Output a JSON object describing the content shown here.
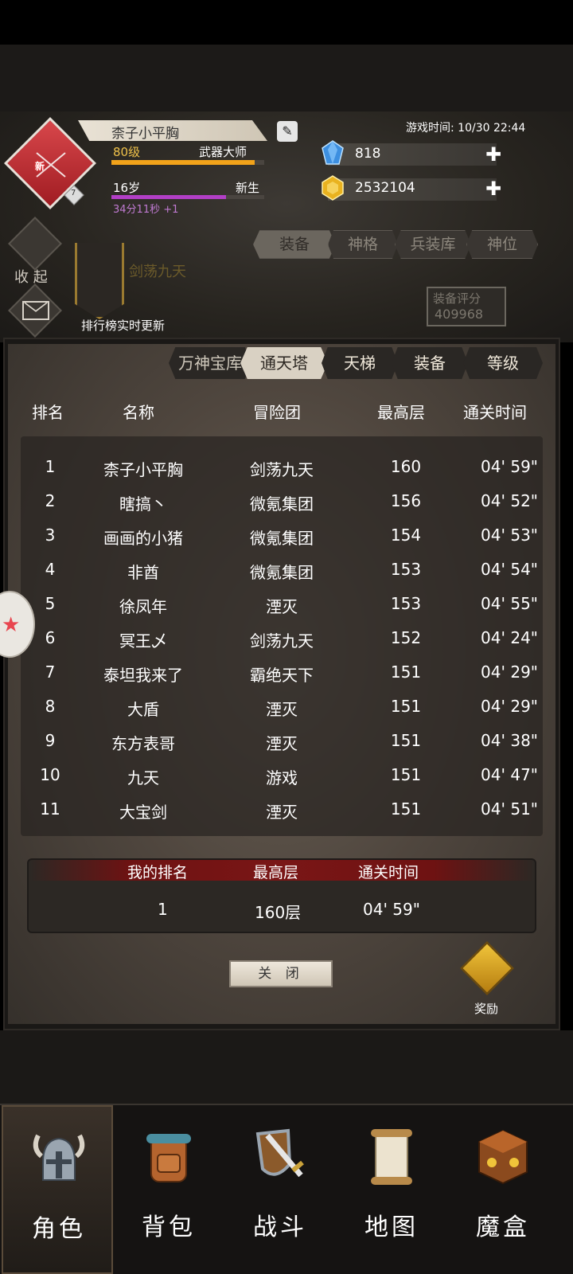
{
  "player": {
    "new_tag": "新",
    "badge_level": "7",
    "name": "柰子小平胸",
    "level": "80级",
    "title": "武器大师",
    "age": "16岁",
    "stage": "新生",
    "timer": "34分11秒 +1"
  },
  "game_time": "游戏时间: 10/30 22:44",
  "currency": {
    "gems": "818",
    "gold": "2532104"
  },
  "side": {
    "collapse": "收 起"
  },
  "guild": {
    "name": "剑荡九天",
    "rank_update": "排行榜实时更新"
  },
  "top_tabs": [
    "装备",
    "神格",
    "兵装库",
    "神位"
  ],
  "score": {
    "label": "装备评分",
    "value": "409968"
  },
  "rank_tabs": [
    "万神宝库",
    "通天塔",
    "天梯",
    "装备",
    "等级"
  ],
  "columns": [
    "排名",
    "名称",
    "冒险团",
    "最高层",
    "通关时间"
  ],
  "rows": [
    {
      "rank": "1",
      "name": "柰子小平胸",
      "guild": "剑荡九天",
      "floor": "160",
      "time": "04' 59\""
    },
    {
      "rank": "2",
      "name": "瞎搞丶",
      "guild": "微氪集团",
      "floor": "156",
      "time": "04' 52\""
    },
    {
      "rank": "3",
      "name": "画画的小猪",
      "guild": "微氪集团",
      "floor": "154",
      "time": "04' 53\""
    },
    {
      "rank": "4",
      "name": "非酋",
      "guild": "微氪集团",
      "floor": "153",
      "time": "04' 54\""
    },
    {
      "rank": "5",
      "name": "徐凤年",
      "guild": "湮灭",
      "floor": "153",
      "time": "04' 55\""
    },
    {
      "rank": "6",
      "name": "冥王乄",
      "guild": "剑荡九天",
      "floor": "152",
      "time": "04' 24\""
    },
    {
      "rank": "7",
      "name": "泰坦我来了",
      "guild": "霸绝天下",
      "floor": "151",
      "time": "04' 29\""
    },
    {
      "rank": "8",
      "name": "大盾",
      "guild": "湮灭",
      "floor": "151",
      "time": "04' 29\""
    },
    {
      "rank": "9",
      "name": "东方表哥",
      "guild": "湮灭",
      "floor": "151",
      "time": "04' 38\""
    },
    {
      "rank": "10",
      "name": "九天",
      "guild": "游戏",
      "floor": "151",
      "time": "04' 47\""
    },
    {
      "rank": "11",
      "name": "大宝剑",
      "guild": "湮灭",
      "floor": "151",
      "time": "04' 51\""
    }
  ],
  "my_rank": {
    "h_rank": "我的排名",
    "h_floor": "最高层",
    "h_time": "通关时间",
    "rank": "1",
    "floor": "160层",
    "time": "04' 59\""
  },
  "close_label": "关 闭",
  "reward_label": "奖励",
  "nav": [
    {
      "label": "角色",
      "icon": "helmet-icon"
    },
    {
      "label": "背包",
      "icon": "backpack-icon"
    },
    {
      "label": "战斗",
      "icon": "sword-shield-icon"
    },
    {
      "label": "地图",
      "icon": "scroll-map-icon"
    },
    {
      "label": "魔盒",
      "icon": "magic-box-icon"
    }
  ]
}
